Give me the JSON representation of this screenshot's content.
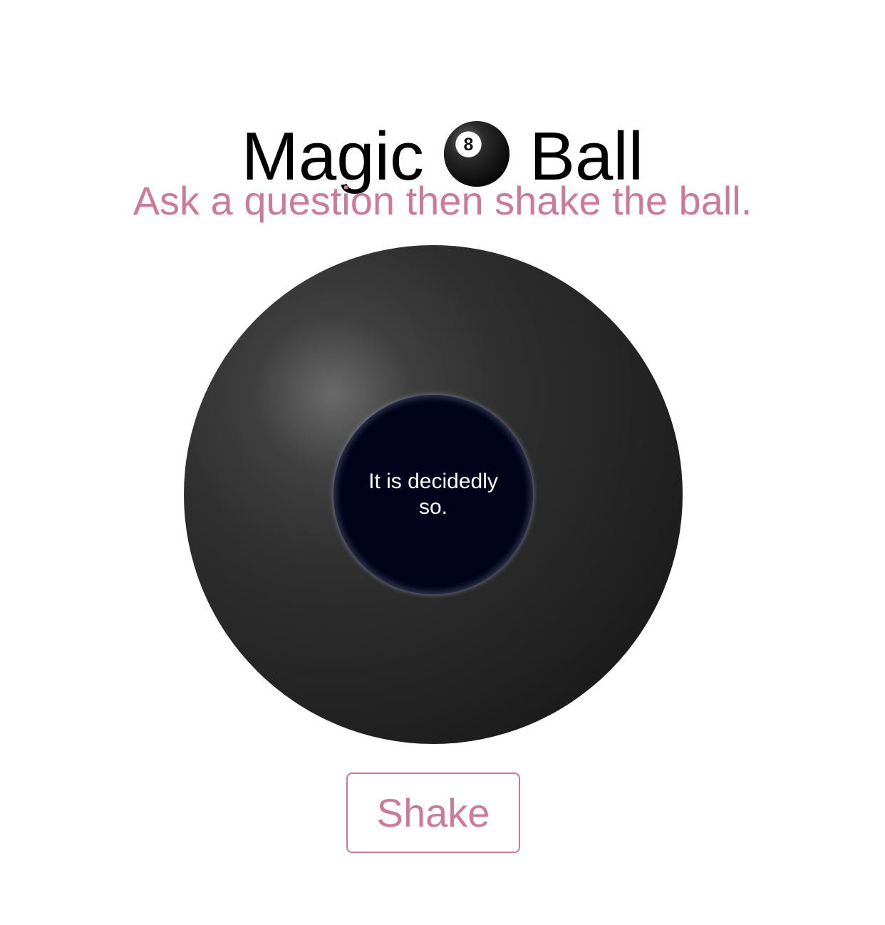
{
  "header": {
    "title_before": "Magic",
    "title_icon": "8-ball-icon",
    "title_after": "Ball",
    "subtitle": "Ask a question then shake the ball."
  },
  "ball": {
    "answer": "It is decidedly so."
  },
  "actions": {
    "shake_label": "Shake"
  },
  "colors": {
    "accent": "#cc7a9a",
    "title_text": "#000000",
    "ball": "#2a2a2a",
    "window": "#02031a",
    "answer_text": "#ffffff"
  }
}
